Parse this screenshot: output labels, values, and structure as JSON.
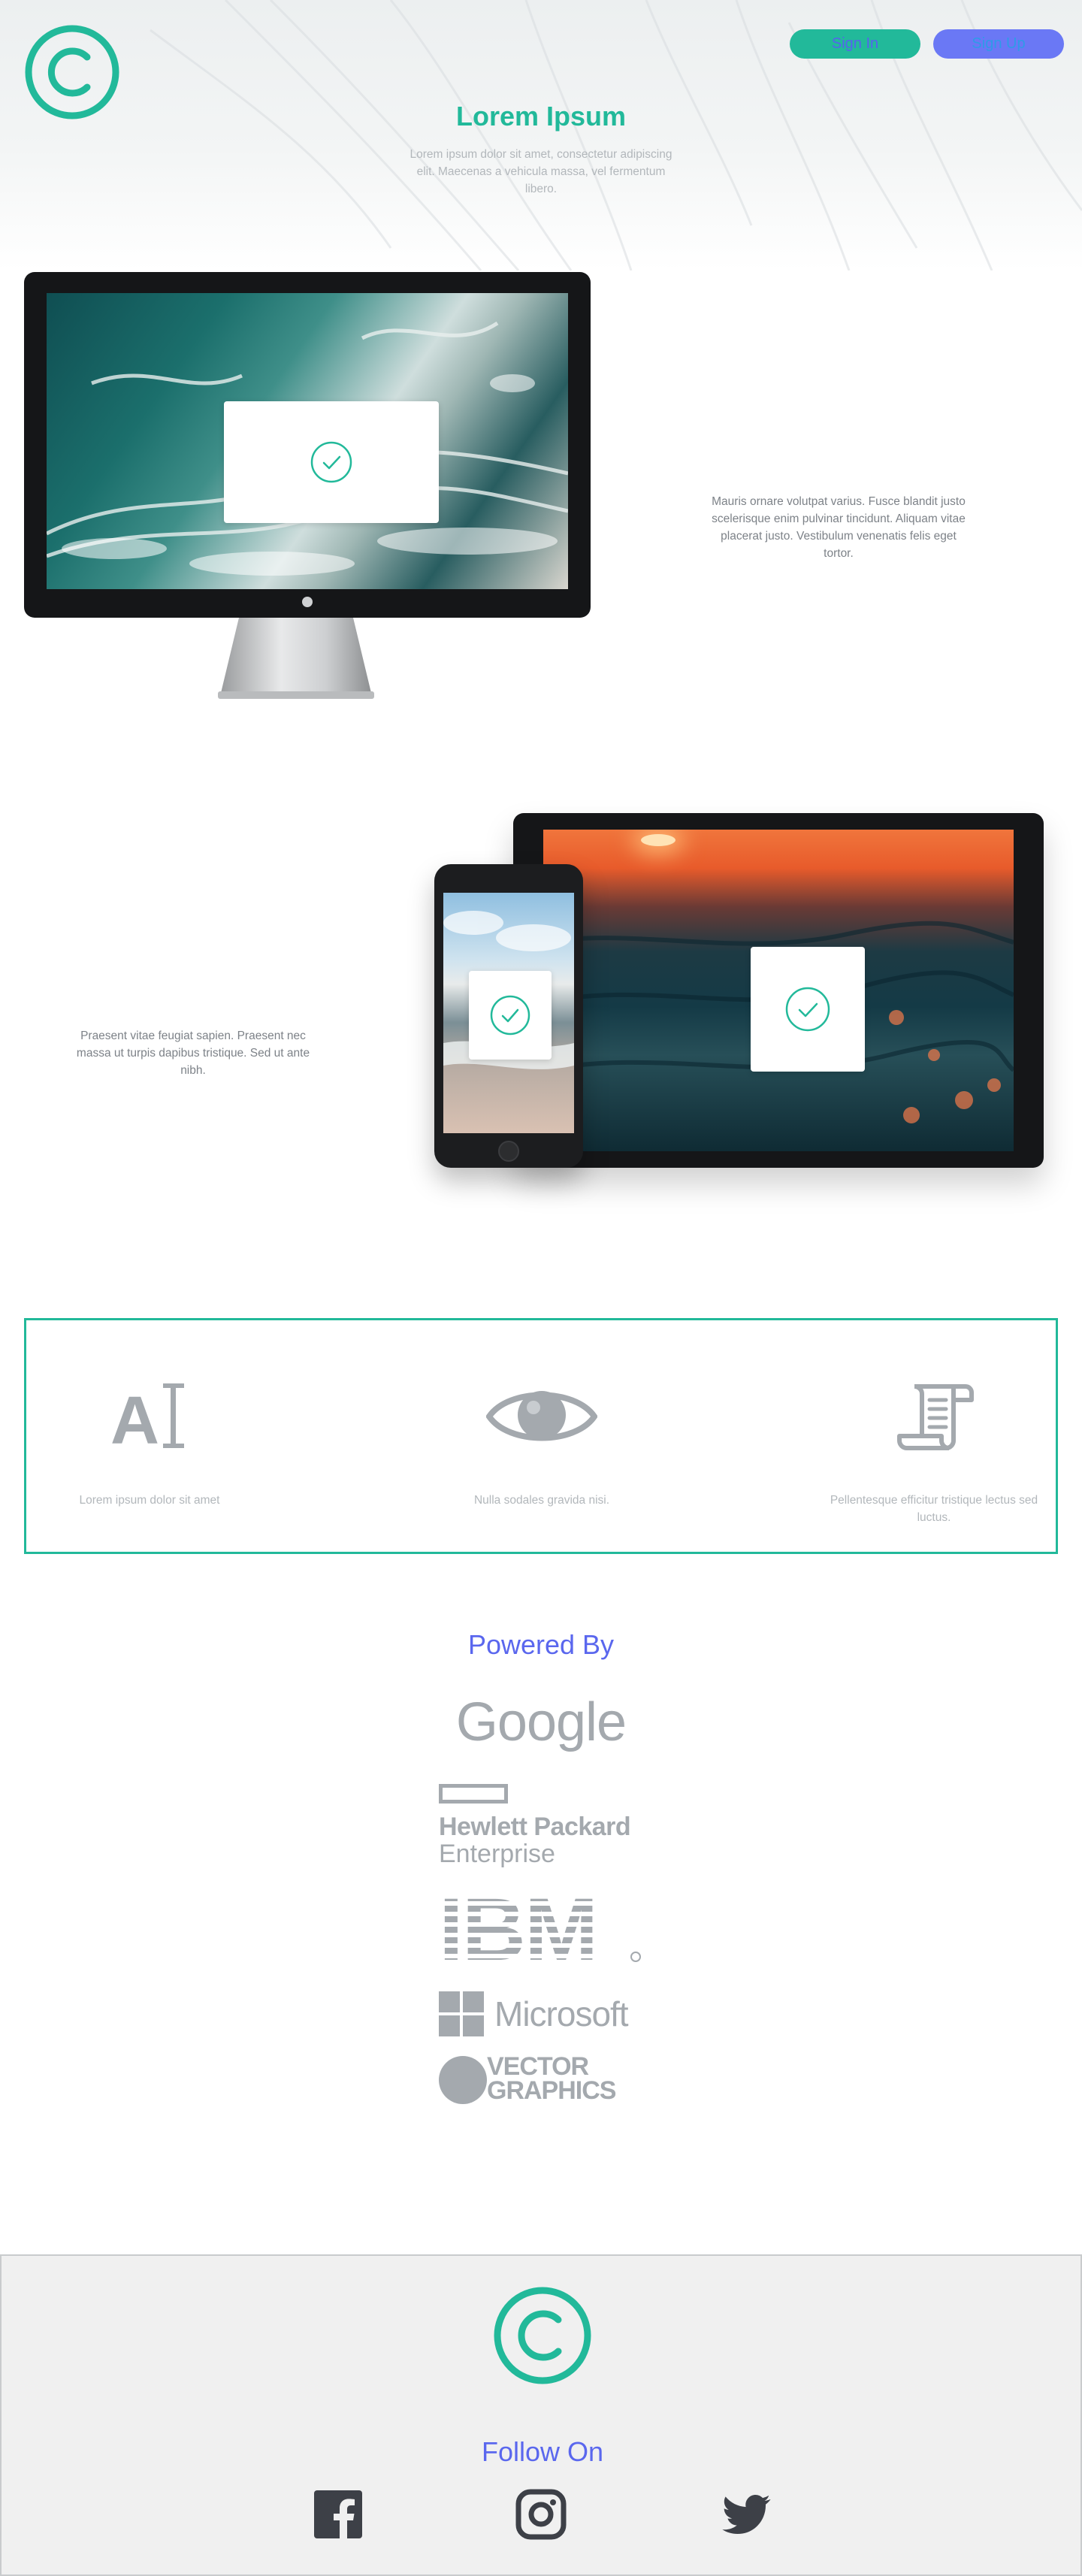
{
  "header": {
    "logo_icon": "copyright-circle-icon",
    "signin_label": "Sign In",
    "signup_label": "Sign Up",
    "title": "Lorem Ipsum",
    "subtitle": "Lorem ipsum dolor sit amet, consectetur adipiscing elit. Maecenas a vehicula massa, vel fermentum libero."
  },
  "sections": {
    "desktop_text": "Mauris ornare volutpat varius. Fusce blandit justo scelerisque enim pulvinar tincidunt. Aliquam vitae placerat justo. Vestibulum venenatis felis eget tortor.",
    "devices_text": "Praesent vitae feugiat sapien. Praesent nec massa ut turpis dapibus tristique. Sed ut ante nibh."
  },
  "features": [
    {
      "icon": "text-cursor-icon",
      "label": "Lorem ipsum dolor sit amet"
    },
    {
      "icon": "eye-icon",
      "label": "Nulla sodales gravida nisi."
    },
    {
      "icon": "scroll-icon",
      "label": "Pellentesque efficitur tristique lectus sed luctus."
    }
  ],
  "powered": {
    "title": "Powered By",
    "brands": {
      "google": "Google",
      "hpe_line1": "Hewlett Packard",
      "hpe_line2": "Enterprise",
      "ibm": "IBM",
      "microsoft": "Microsoft",
      "vector_line1": "VECTOR",
      "vector_line2": "GRAPHICS"
    }
  },
  "footer": {
    "follow_title": "Follow On",
    "social": [
      "facebook-icon",
      "instagram-icon",
      "twitter-icon"
    ]
  },
  "colors": {
    "accent_green": "#22b99a",
    "accent_blue": "#5a67ee",
    "signup_blue": "#6a78f5",
    "text_gray": "#7d8288",
    "footer_bg": "#f0f0f0"
  }
}
